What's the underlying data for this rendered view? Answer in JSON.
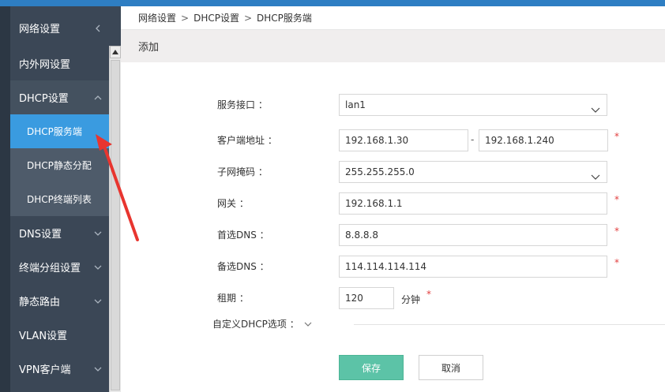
{
  "sidebar": {
    "items": [
      {
        "label": "网络设置"
      },
      {
        "label": "内外网设置"
      },
      {
        "label": "DHCP设置"
      },
      {
        "label": "DHCP服务端"
      },
      {
        "label": "DHCP静态分配"
      },
      {
        "label": "DHCP终端列表"
      },
      {
        "label": "DNS设置"
      },
      {
        "label": "终端分组设置"
      },
      {
        "label": "静态路由"
      },
      {
        "label": "VLAN设置"
      },
      {
        "label": "VPN客户端"
      }
    ]
  },
  "breadcrumb": {
    "items": [
      "网络设置",
      "DHCP设置",
      "DHCP服务端"
    ],
    "separator": ">"
  },
  "panel": {
    "title": "添加"
  },
  "form": {
    "interface": {
      "label": "服务接口 ：",
      "value": "lan1"
    },
    "client_address": {
      "label": "客户端地址 ：",
      "start": "192.168.1.30",
      "dash": "-",
      "end": "192.168.1.240",
      "required": "*"
    },
    "netmask": {
      "label": "子网掩码 ：",
      "value": "255.255.255.0"
    },
    "gateway": {
      "label": "网关 ：",
      "value": "192.168.1.1",
      "required": "*"
    },
    "primary_dns": {
      "label": "首选DNS ：",
      "value": "8.8.8.8",
      "required": "*"
    },
    "secondary_dns": {
      "label": "备选DNS ：",
      "value": "114.114.114.114",
      "required": "*"
    },
    "lease": {
      "label": "租期 ：",
      "value": "120",
      "unit": "分钟",
      "required": "*"
    },
    "custom_options": {
      "label": "自定义DHCP选项 ："
    },
    "save_label": "保存",
    "cancel_label": "取消"
  },
  "colors": {
    "accent": "#3a9be0",
    "save": "#5cc3a7",
    "required": "#e24040",
    "annotation": "#e8352f"
  }
}
